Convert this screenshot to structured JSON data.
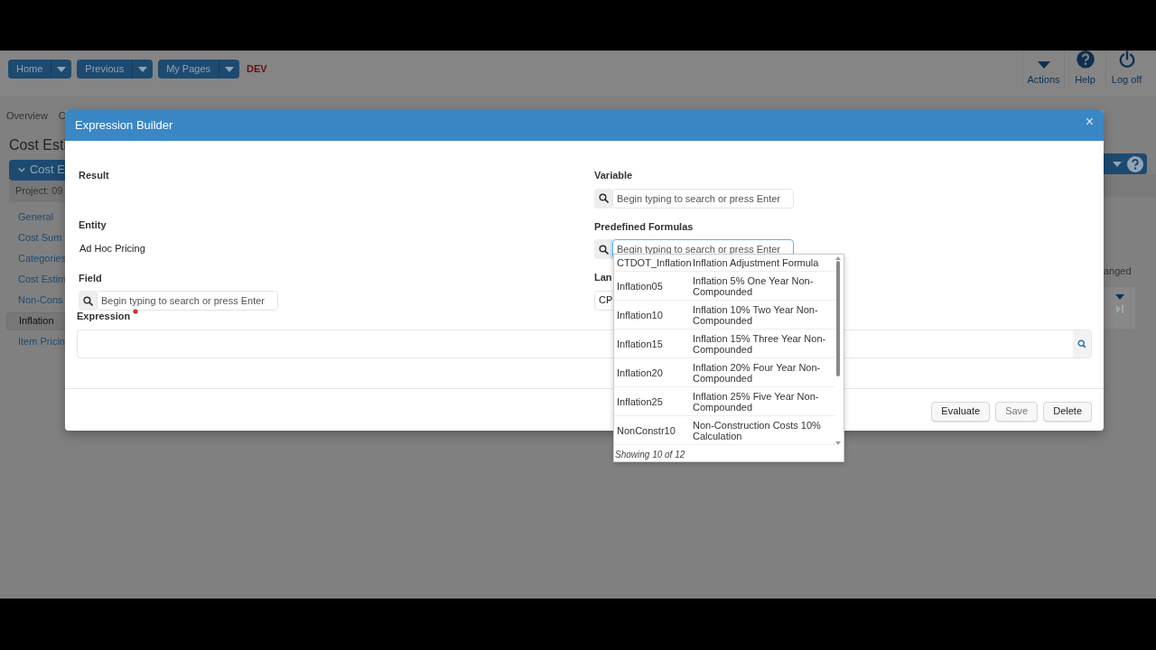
{
  "nav": {
    "buttons": [
      {
        "label": "Home"
      },
      {
        "label": "Previous"
      },
      {
        "label": "My Pages"
      }
    ],
    "env": "DEV",
    "actions": [
      {
        "kind": "caret",
        "label": "Actions"
      },
      {
        "kind": "help",
        "label": "Help"
      },
      {
        "kind": "power",
        "label": "Log off"
      }
    ]
  },
  "page": {
    "tabs": [
      "Overview",
      "C"
    ],
    "title": "Cost Esti",
    "panel_title": "Cost E",
    "project": "Project: 09",
    "sidebar": [
      {
        "label": "General",
        "selected": false
      },
      {
        "label": "Cost Sum",
        "selected": false
      },
      {
        "label": "Categories",
        "selected": false
      },
      {
        "label": "Cost Estim",
        "selected": false
      },
      {
        "label": "Non-Cons",
        "selected": false
      },
      {
        "label": "Inflation",
        "selected": true
      },
      {
        "label": "Item Pricin",
        "selected": false
      }
    ],
    "right_text": "anged"
  },
  "dialog": {
    "title": "Expression Builder",
    "close": "×",
    "result": {
      "label": "Result"
    },
    "entity": {
      "label": "Entity",
      "value": "Ad Hoc Pricing"
    },
    "field": {
      "label": "Field",
      "placeholder": "Begin typing to search or press Enter"
    },
    "expression": {
      "label": "Expression",
      "required": true
    },
    "variable": {
      "label": "Variable",
      "placeholder": "Begin typing to search or press Enter"
    },
    "formulas": {
      "label": "Predefined Formulas",
      "placeholder": "Begin typing to search or press Enter",
      "focused": true
    },
    "language": {
      "label": "Lan",
      "value": "CP"
    },
    "buttons": [
      {
        "label": "Evaluate",
        "disabled": false
      },
      {
        "label": "Save",
        "disabled": true
      },
      {
        "label": "Delete",
        "disabled": false
      }
    ],
    "dropdown": {
      "items": [
        {
          "code": "CTDOT_Inflation",
          "description": "Inflation Adjustment Formula"
        },
        {
          "code": "Inflation05",
          "description": "Inflation 5% One Year Non-Compounded"
        },
        {
          "code": "Inflation10",
          "description": "Inflation 10% Two Year Non-Compounded"
        },
        {
          "code": "Inflation15",
          "description": "Inflation 15% Three Year Non-Compounded"
        },
        {
          "code": "Inflation20",
          "description": "Inflation 20% Four Year Non-Compounded"
        },
        {
          "code": "Inflation25",
          "description": "Inflation 25% Five Year Non-Compounded"
        },
        {
          "code": "NonConstr10",
          "description": "Non-Construction Costs 10% Calculation"
        }
      ],
      "footer": "Showing 10 of 12"
    }
  }
}
